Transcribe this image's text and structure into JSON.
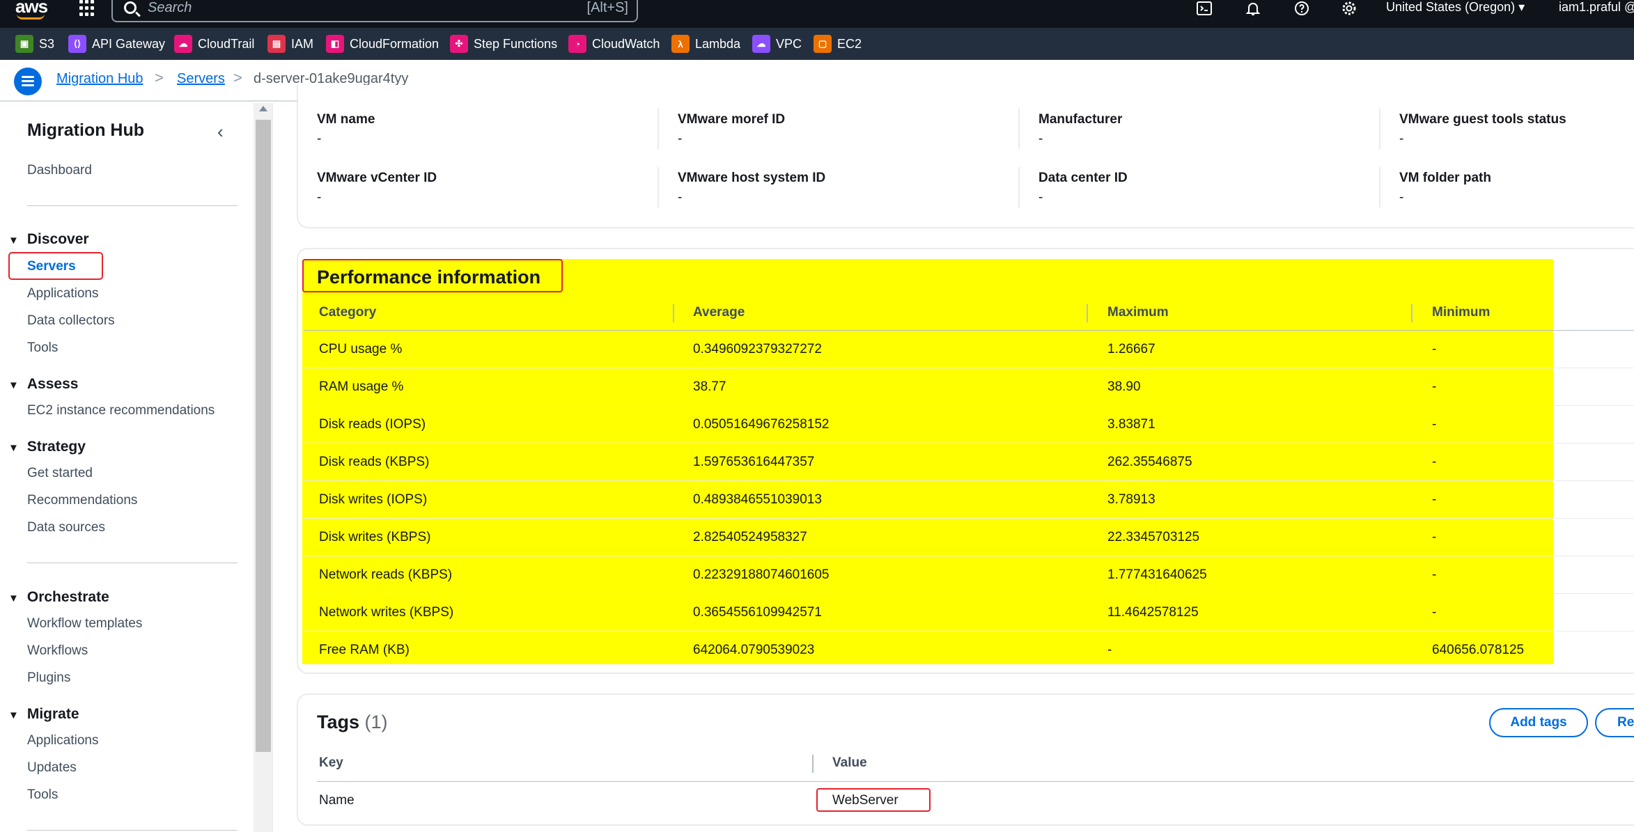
{
  "topnav": {
    "logo": "aws",
    "search_placeholder": "Search",
    "search_shortcut": "[Alt+S]",
    "region": "United States (Oregon) ▾",
    "user": "iam1.praful @"
  },
  "favorites": [
    {
      "label": "S3",
      "icon": "s3-icon",
      "color": "#3f8624"
    },
    {
      "label": "API Gateway",
      "icon": "api-gateway-icon",
      "color": "#8c4fff"
    },
    {
      "label": "CloudTrail",
      "icon": "cloudtrail-icon",
      "color": "#e7157b"
    },
    {
      "label": "IAM",
      "icon": "iam-icon",
      "color": "#dd344c"
    },
    {
      "label": "CloudFormation",
      "icon": "cloudformation-icon",
      "color": "#e7157b"
    },
    {
      "label": "Step Functions",
      "icon": "step-functions-icon",
      "color": "#e7157b"
    },
    {
      "label": "CloudWatch",
      "icon": "cloudwatch-icon",
      "color": "#e7157b"
    },
    {
      "label": "Lambda",
      "icon": "lambda-icon",
      "color": "#ed7100"
    },
    {
      "label": "VPC",
      "icon": "vpc-icon",
      "color": "#8c4fff"
    },
    {
      "label": "EC2",
      "icon": "ec2-icon",
      "color": "#ed7100"
    }
  ],
  "breadcrumb": {
    "items": [
      "Migration Hub",
      "Servers",
      "d-server-01ake9ugar4tyy"
    ],
    "separator": ">"
  },
  "sidebar": {
    "title": "Migration Hub",
    "dashboard": "Dashboard",
    "sections": [
      {
        "title": "Discover",
        "items": [
          "Servers",
          "Applications",
          "Data collectors",
          "Tools"
        ]
      },
      {
        "title": "Assess",
        "items": [
          "EC2 instance recommendations"
        ]
      },
      {
        "title": "Strategy",
        "items": [
          "Get started",
          "Recommendations",
          "Data sources"
        ]
      },
      {
        "title": "Orchestrate",
        "items": [
          "Workflow templates",
          "Workflows",
          "Plugins"
        ]
      },
      {
        "title": "Migrate",
        "items": [
          "Applications",
          "Updates",
          "Tools"
        ]
      }
    ],
    "active_item": "Servers"
  },
  "vm_details": [
    {
      "label": "VM name",
      "value": "-"
    },
    {
      "label": "VMware moref ID",
      "value": "-"
    },
    {
      "label": "Manufacturer",
      "value": "-"
    },
    {
      "label": "VMware guest tools status",
      "value": "-"
    },
    {
      "label": "VMware vCenter ID",
      "value": "-"
    },
    {
      "label": "VMware host system ID",
      "value": "-"
    },
    {
      "label": "Data center ID",
      "value": "-"
    },
    {
      "label": "VM folder path",
      "value": "-"
    }
  ],
  "performance": {
    "title": "Performance information",
    "columns": [
      "Category",
      "Average",
      "Maximum",
      "Minimum"
    ],
    "rows": [
      [
        "CPU usage %",
        "0.3496092379327272",
        "1.26667",
        "-"
      ],
      [
        "RAM usage %",
        "38.77",
        "38.90",
        "-"
      ],
      [
        "Disk reads (IOPS)",
        "0.05051649676258152",
        "3.83871",
        "-"
      ],
      [
        "Disk reads (KBPS)",
        "1.597653616447357",
        "262.35546875",
        "-"
      ],
      [
        "Disk writes (IOPS)",
        "0.4893846551039013",
        "3.78913",
        "-"
      ],
      [
        "Disk writes (KBPS)",
        "2.82540524958327",
        "22.3345703125",
        "-"
      ],
      [
        "Network reads (KBPS)",
        "0.22329188074601605",
        "1.777431640625",
        "-"
      ],
      [
        "Network writes (KBPS)",
        "0.3654556109942571",
        "11.4642578125",
        "-"
      ],
      [
        "Free RAM (KB)",
        "642064.0790539023",
        "-",
        "640656.078125"
      ]
    ],
    "highlight_color": "#ffff00"
  },
  "tags": {
    "title": "Tags",
    "count": "(1)",
    "add_button": "Add tags",
    "remove_button": "Re",
    "columns": [
      "Key",
      "Value"
    ],
    "rows": [
      [
        "Name",
        "WebServer"
      ]
    ]
  },
  "colors": {
    "annotation_red": "#e8222e",
    "link_blue": "#006ce0",
    "nav_dark": "#0f141a",
    "favbar": "#232f3e"
  }
}
